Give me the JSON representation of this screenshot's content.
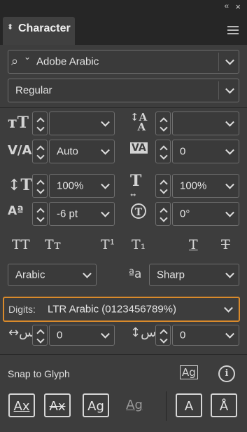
{
  "panel": {
    "collapse_glyph": "‹‹",
    "close_glyph": "×",
    "tab_icon": "⬍",
    "title": "Character"
  },
  "font": {
    "search_glyph": "⌕",
    "family": "Adobe Arabic",
    "style": "Regular"
  },
  "size_row": {
    "font_size_value": "",
    "leading_value": ""
  },
  "kerning_row": {
    "kerning_value": "Auto",
    "tracking_value": "0"
  },
  "scale_row": {
    "vertical_scale_value": "100%",
    "horizontal_scale_value": "100%"
  },
  "baseline_row": {
    "baseline_shift_value": "-6 pt",
    "rotation_value": "0°"
  },
  "text_styles": {
    "all_caps": "TT",
    "small_caps": "Tᴛ",
    "superscript": "T¹",
    "subscript": "T₁",
    "underline": "T",
    "strikethrough": "T"
  },
  "language": "Arabic",
  "antialias_glyph": "ªa",
  "antialiasing": "Sharp",
  "digits": {
    "label": "Digits:",
    "value": "LTR Arabic (0123456789%)"
  },
  "diacritic_row": {
    "x_position_value": "0",
    "y_position_value": "0"
  },
  "snap": {
    "label": "Snap to Glyph",
    "info_glyph": "i"
  },
  "snap_buttons": [
    "Ax",
    "Ax",
    "Ag",
    "Ag",
    "A",
    "Å"
  ]
}
